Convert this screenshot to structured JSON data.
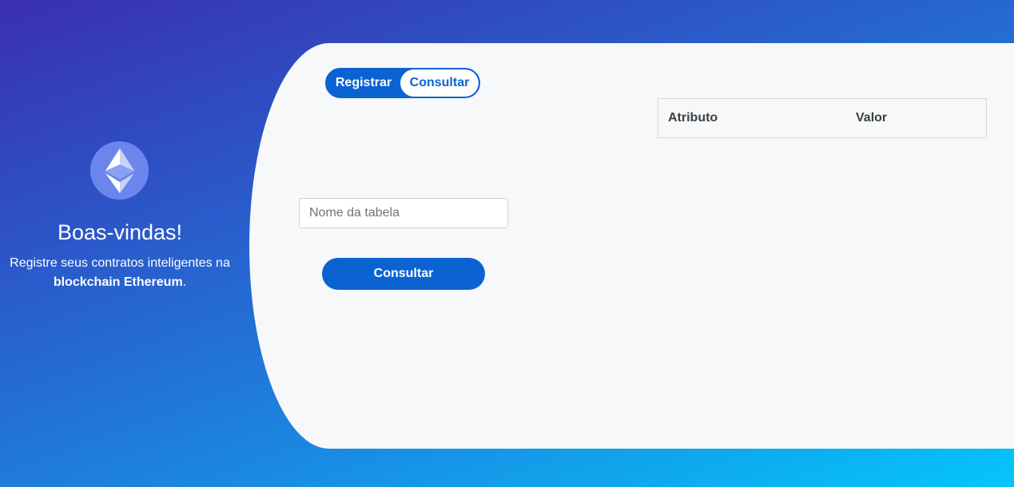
{
  "welcome": {
    "title": "Boas-vindas!",
    "text_before": "Registre seus contratos inteligentes na ",
    "text_bold": "blockchain Ethereum",
    "text_after": "."
  },
  "logo": {
    "icon": "ethereum-icon",
    "color": "#6b85ec"
  },
  "tabs": {
    "registrar_label": "Registrar",
    "consultar_label": "Consultar",
    "active": "Consultar"
  },
  "form": {
    "table_name_placeholder": "Nome da tabela",
    "table_name_value": "",
    "submit_label": "Consultar"
  },
  "results_table": {
    "headers": [
      "Atributo",
      "Valor"
    ],
    "rows": []
  },
  "colors": {
    "primary": "#0b63d1",
    "card_background": "#f6f8fa",
    "gradient_start": "#3a2fb0",
    "gradient_end": "#04c6fb"
  }
}
